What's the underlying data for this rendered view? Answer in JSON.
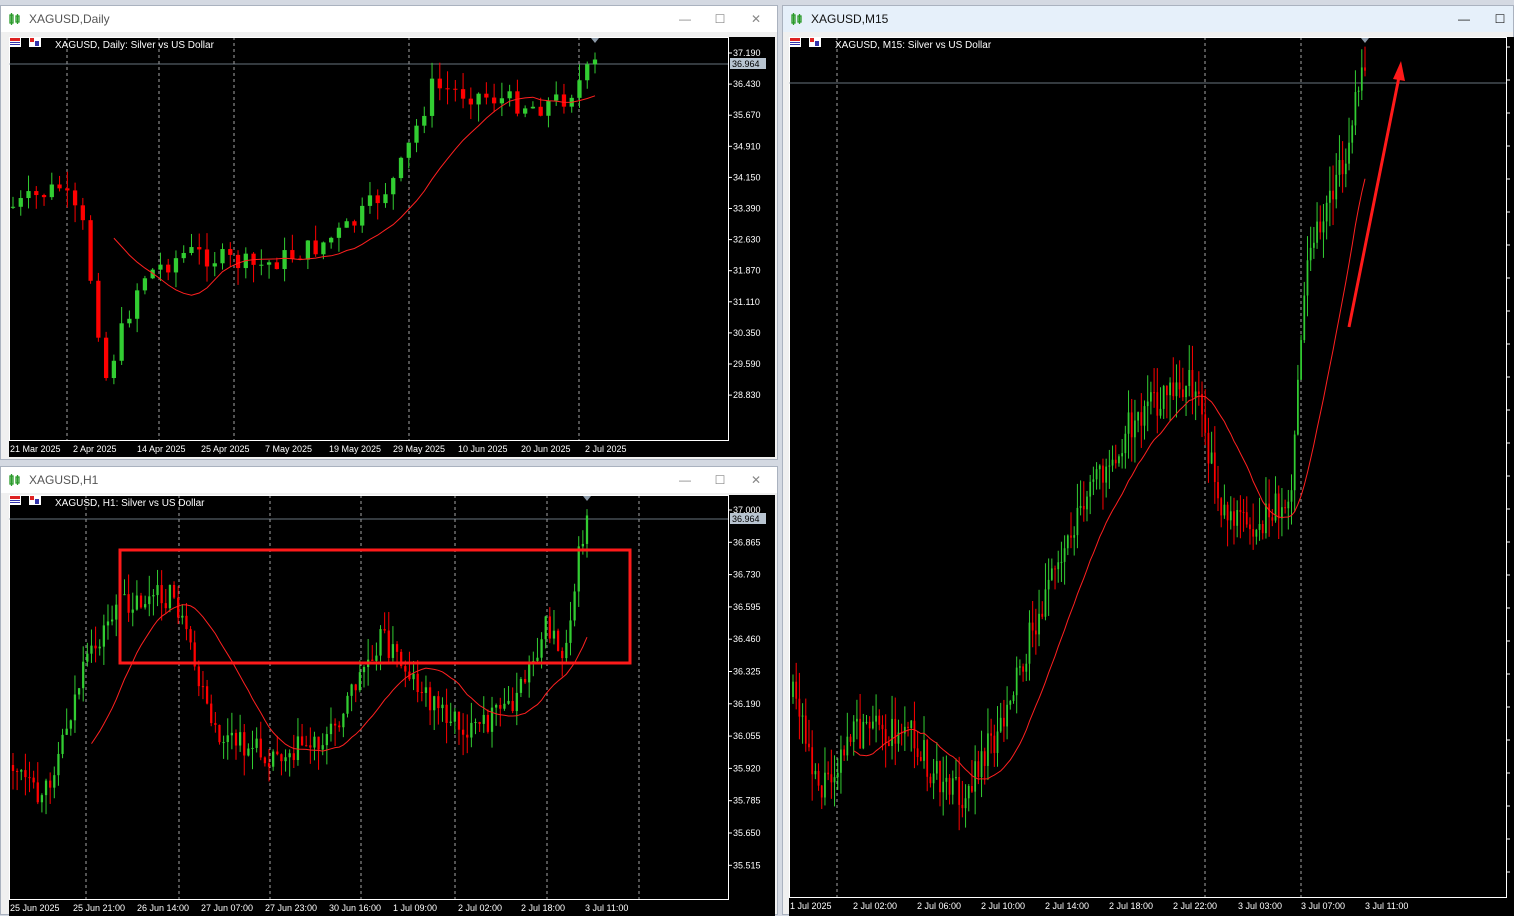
{
  "windows": {
    "daily": {
      "title": "XAGUSD,Daily",
      "chart_label": "XAGUSD, Daily:  Silver vs US Dollar",
      "current_price": "36.964",
      "price_ticks": [
        "37.190",
        "36.430",
        "35.670",
        "34.910",
        "34.150",
        "33.390",
        "32.630",
        "31.870",
        "31.110",
        "30.350",
        "29.590",
        "28.830"
      ],
      "time_ticks": [
        "21 Mar 2025",
        "2 Apr 2025",
        "14 Apr 2025",
        "25 Apr 2025",
        "7 May 2025",
        "19 May 2025",
        "29 May 2025",
        "10 Jun 2025",
        "20 Jun 2025",
        "2 Jul 2025"
      ]
    },
    "h1": {
      "title": "XAGUSD,H1",
      "chart_label": "XAGUSD, H1:  Silver vs US Dollar",
      "current_price": "36.964",
      "price_ticks": [
        "37.000",
        "36.865",
        "36.730",
        "36.595",
        "36.460",
        "36.325",
        "36.190",
        "36.055",
        "35.920",
        "35.785",
        "35.650",
        "35.515"
      ],
      "time_ticks": [
        "25 Jun 2025",
        "25 Jun 21:00",
        "26 Jun 14:00",
        "27 Jun 07:00",
        "27 Jun 23:00",
        "30 Jun 16:00",
        "1 Jul 09:00",
        "2 Jul 02:00",
        "2 Jul 18:00",
        "3 Jul 11:00"
      ]
    },
    "m15": {
      "title": "XAGUSD,M15",
      "chart_label": "XAGUSD, M15:  Silver vs US Dollar",
      "time_ticks": [
        "1 Jul 2025",
        "2 Jul 02:00",
        "2 Jul 06:00",
        "2 Jul 10:00",
        "2 Jul 14:00",
        "2 Jul 18:00",
        "2 Jul 22:00",
        "3 Jul 03:00",
        "3 Jul 07:00",
        "3 Jul 11:00"
      ]
    }
  },
  "colors": {
    "bull": "#32cd32",
    "bear": "#ff0000",
    "ma": "#ff2020",
    "annotation": "#ff1a1a",
    "grid": "#ffffff",
    "background": "#000000"
  },
  "icons": [
    "chart-window-icon",
    "symbol-flag-icon",
    "minimize-icon",
    "maximize-icon",
    "close-icon"
  ]
}
